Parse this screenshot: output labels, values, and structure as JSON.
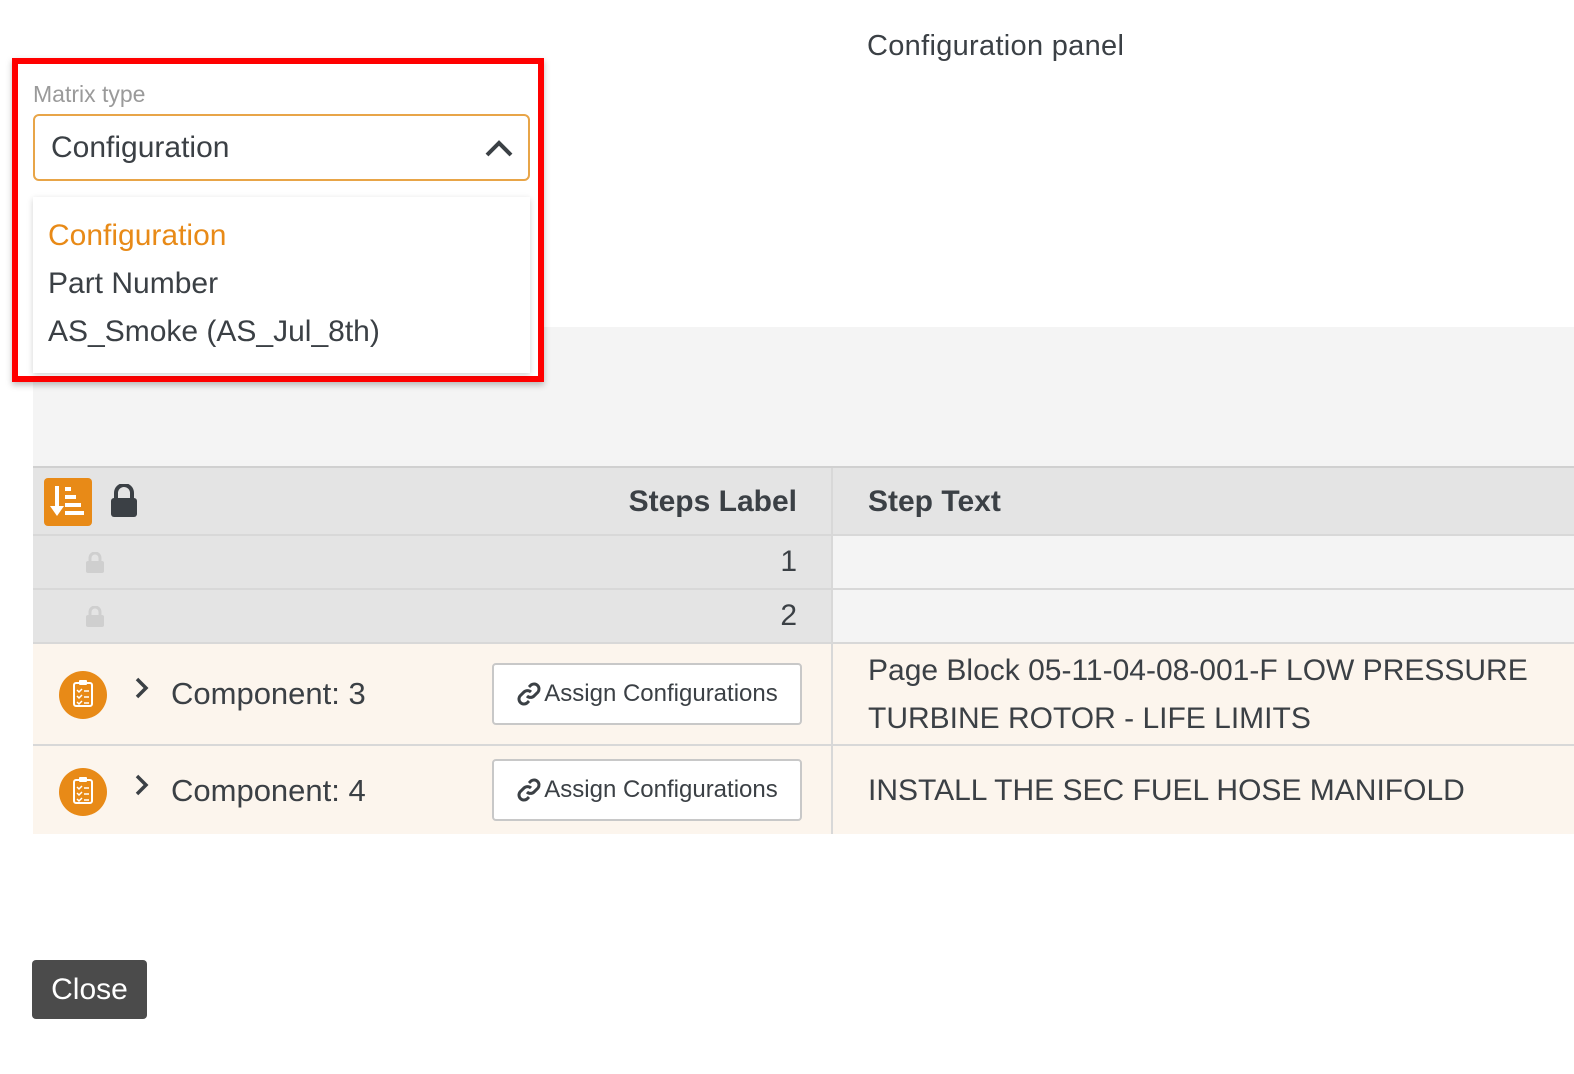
{
  "panel": {
    "title": "Configuration panel"
  },
  "matrix_type": {
    "label": "Matrix type",
    "selected": "Configuration",
    "options": [
      "Configuration",
      "Part Number",
      "AS_Smoke (AS_Jul_8th)"
    ]
  },
  "table": {
    "header": {
      "steps_label": "Steps Label",
      "step_text": "Step Text"
    },
    "steps": [
      "1",
      "2"
    ],
    "components": [
      {
        "label": "Component: 3",
        "button": "Assign Configurations",
        "text": "Page Block 05-11-04-08-001-F LOW PRESSURE TURBINE ROTOR - LIFE LIMITS"
      },
      {
        "label": "Component: 4",
        "button": "Assign Configurations",
        "text": "INSTALL THE SEC FUEL HOSE MANIFOLD"
      }
    ]
  },
  "footer": {
    "close_label": "Close"
  },
  "colors": {
    "accent": "#e88a17",
    "highlight": "#ff0000",
    "component_row": "#fcf5ed"
  }
}
